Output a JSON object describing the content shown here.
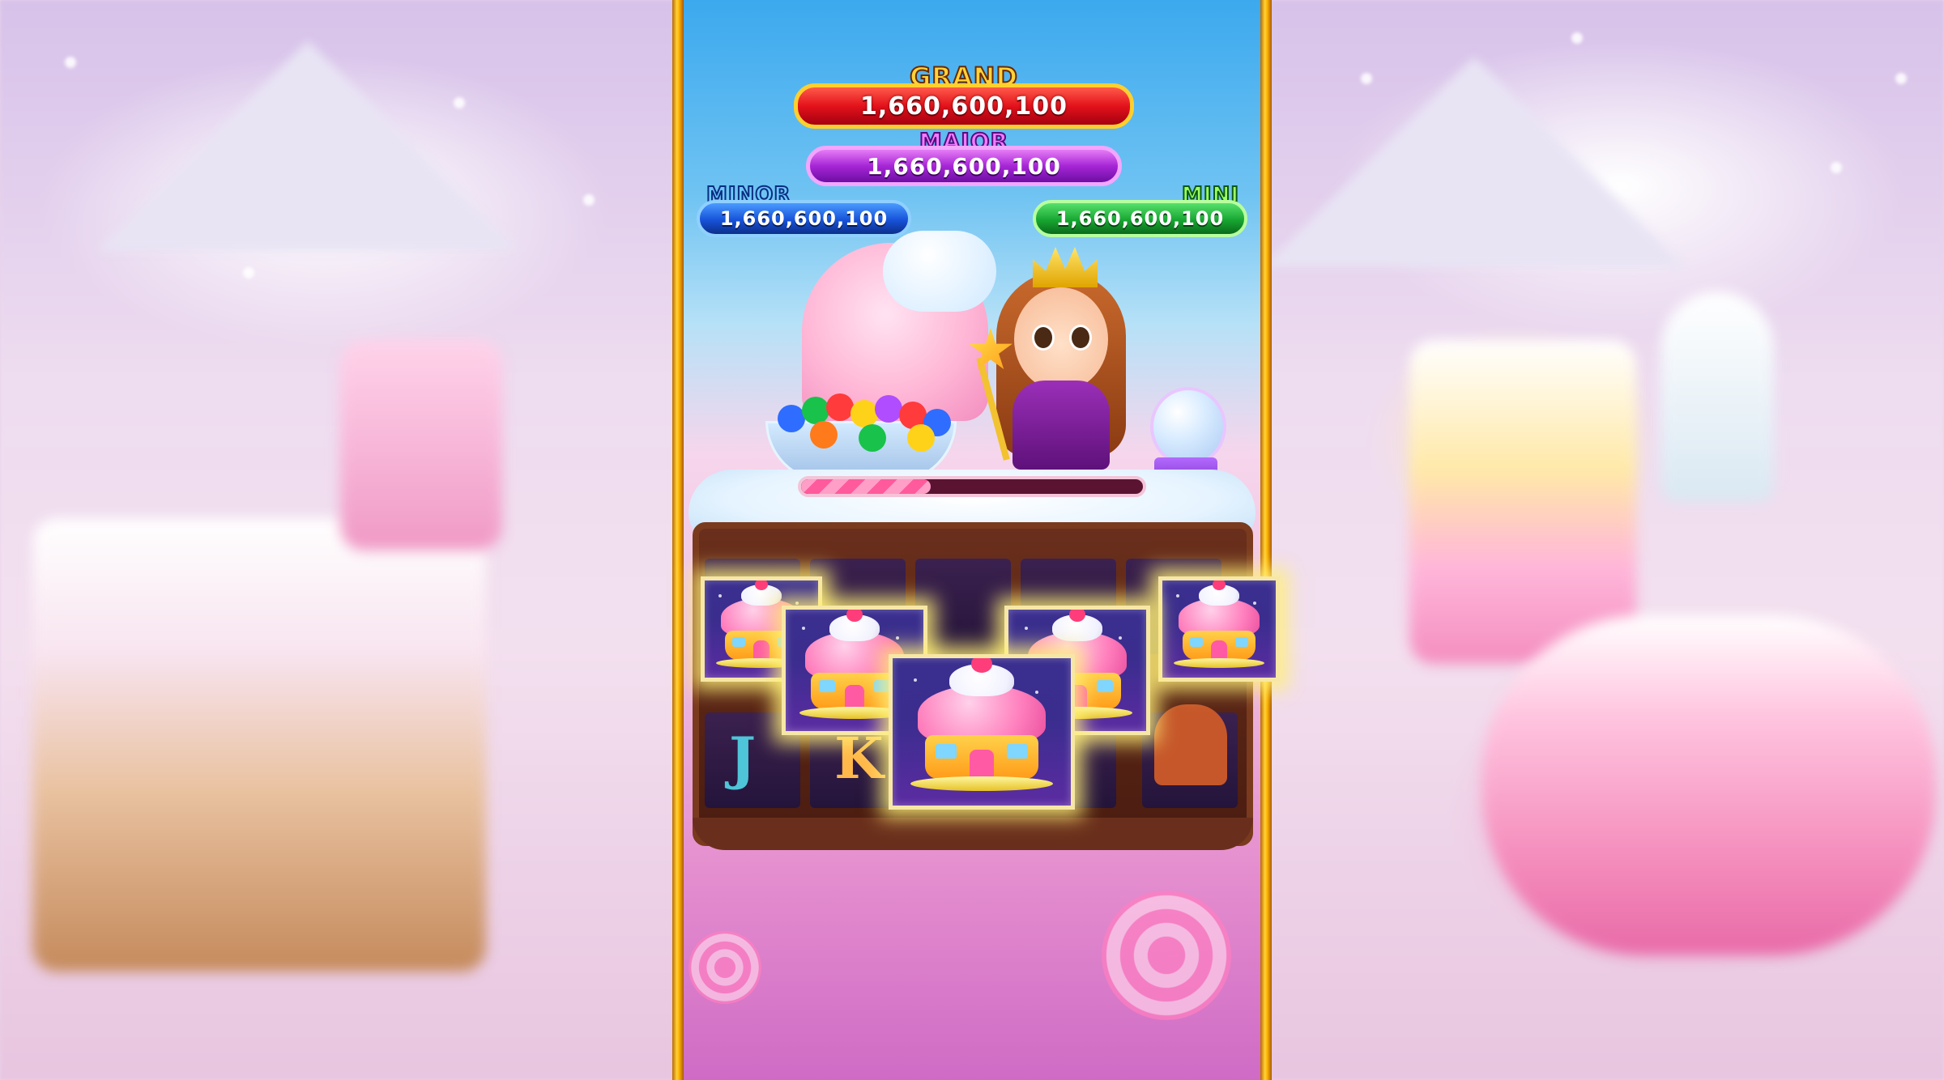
{
  "jackpots": {
    "grand": {
      "label": "GRAND",
      "value": "1,660,600,100",
      "color": "#e3121b"
    },
    "major": {
      "label": "MAJOR",
      "value": "1,660,600,100",
      "color": "#a626d6"
    },
    "minor": {
      "label": "MINOR",
      "value": "1,660,600,100",
      "color": "#1652d9"
    },
    "mini": {
      "label": "MINI",
      "value": "1,660,600,100",
      "color": "#17a631"
    }
  },
  "progress": {
    "fraction": 0.38
  },
  "reels": {
    "symbols": [
      "cupcake-house",
      "cupcake-house",
      "cupcake-house",
      "cupcake-house",
      "cupcake-house",
      "cupcake-house"
    ],
    "background_glyphs": [
      "J",
      "K"
    ]
  },
  "theme": {
    "accent": "#ffd23a",
    "frame_color": "#6a2f1c"
  }
}
